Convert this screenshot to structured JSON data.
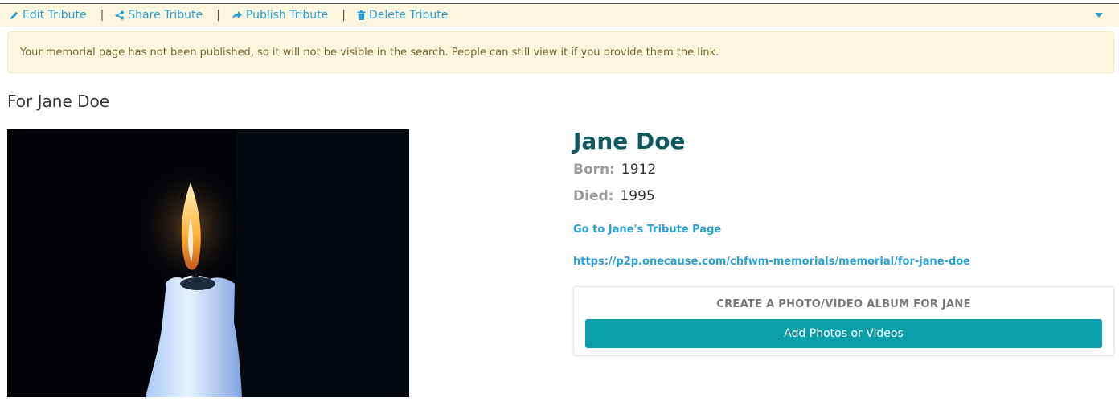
{
  "toolbar": {
    "edit_label": "Edit Tribute",
    "share_label": "Share Tribute",
    "publish_label": "Publish Tribute",
    "delete_label": "Delete Tribute",
    "separator": "|"
  },
  "alert": {
    "message": "Your memorial page has not been published, so it will not be visible in the search. People can still view it if you provide them the link."
  },
  "page_title": "For Jane Doe",
  "memorial": {
    "name": "Jane Doe",
    "born_label": "Born:",
    "born_value": "1912",
    "died_label": "Died:",
    "died_value": "1995",
    "tribute_link": "Go to Jane's Tribute Page",
    "url": "https://p2p.onecause.com/chfwm-memorials/memorial/for-jane-doe"
  },
  "album": {
    "title": "CREATE A PHOTO/VIDEO ALBUM FOR JANE",
    "button_label": "Add Photos or Videos"
  },
  "colors": {
    "toolbar_bg": "#fcf6df",
    "link": "#2a9fd6",
    "name": "#0f5a5e",
    "button": "#0a9ea8"
  },
  "icons": [
    "pencil-icon",
    "share-icon",
    "publish-arrow-icon",
    "trash-icon",
    "caret-down-icon"
  ]
}
